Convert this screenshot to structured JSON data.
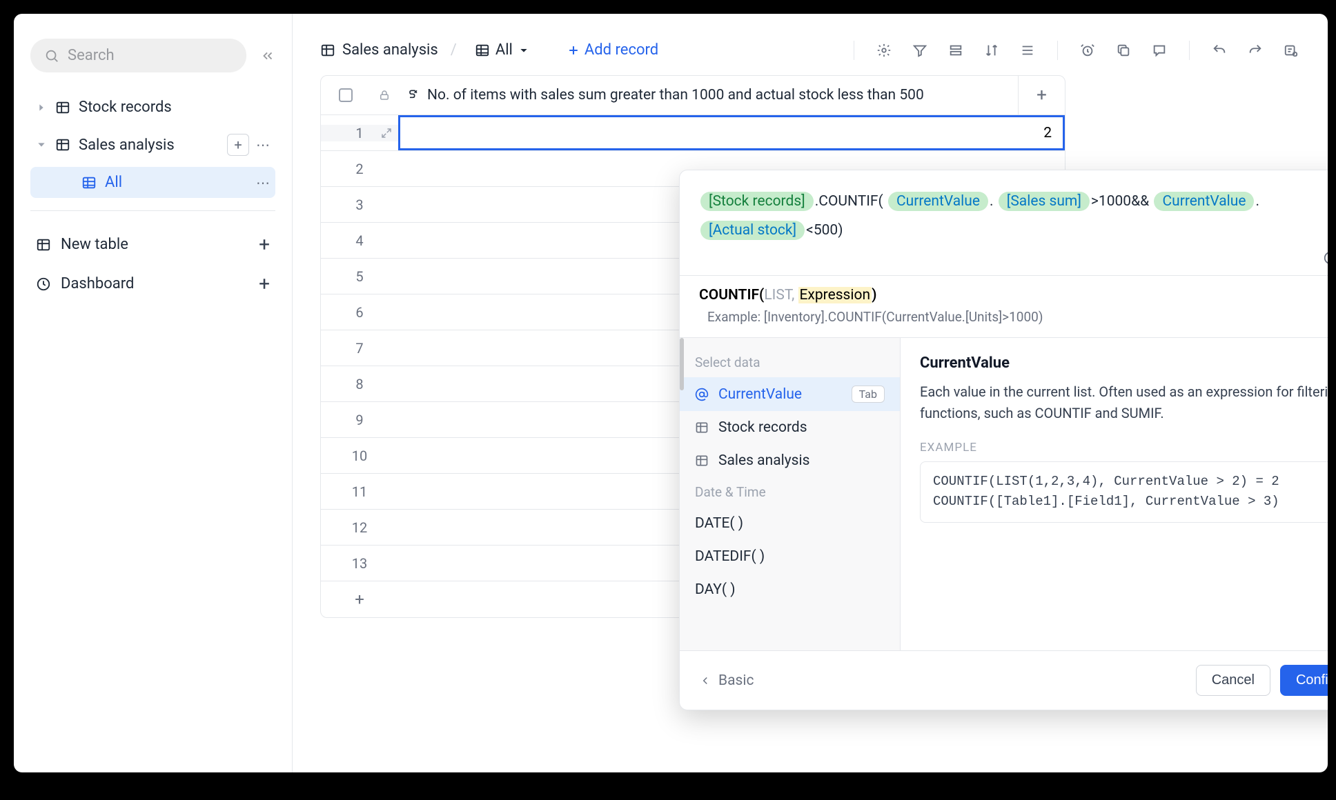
{
  "sidebar": {
    "search_placeholder": "Search",
    "tables": [
      {
        "label": "Stock records",
        "expanded": false
      },
      {
        "label": "Sales analysis",
        "expanded": true,
        "views": [
          {
            "label": "All",
            "active": true
          }
        ]
      }
    ],
    "actions": {
      "new_table": "New table",
      "dashboard": "Dashboard"
    }
  },
  "header": {
    "table": "Sales analysis",
    "view": "All",
    "add_record": "Add record"
  },
  "grid": {
    "column_label": "No. of items with sales sum greater than 1000 and actual stock less than 500",
    "rows": [
      {
        "n": 1,
        "value": "2",
        "selected": true
      },
      {
        "n": 2
      },
      {
        "n": 3
      },
      {
        "n": 4
      },
      {
        "n": 5
      },
      {
        "n": 6
      },
      {
        "n": 7
      },
      {
        "n": 8
      },
      {
        "n": 9
      },
      {
        "n": 10
      },
      {
        "n": 11
      },
      {
        "n": 12
      },
      {
        "n": 13
      }
    ]
  },
  "formula": {
    "tokens": {
      "stock_records": "[Stock records]",
      "countif": ".COUNTIF(",
      "current_value_1": "CurrentValue",
      "dot": ".",
      "sales_sum": "[Sales sum]",
      "gt_and": ">1000&&",
      "current_value_2": "CurrentValue",
      "dot2": ".",
      "actual_stock": "[Actual stock]",
      "lt_close": "<500)"
    },
    "signature": {
      "name": "COUNTIF(",
      "arg1": "LIST",
      "comma": ", ",
      "arg2": "Expression",
      "close": ")",
      "example": "Example: [Inventory].COUNTIF(CurrentValue.[Units]>1000)"
    },
    "suggestions": {
      "cat1": "Select data",
      "items1": [
        {
          "label": "CurrentValue",
          "icon": "at",
          "selected": true,
          "badge": "Tab"
        },
        {
          "label": "Stock records",
          "icon": "table"
        },
        {
          "label": "Sales analysis",
          "icon": "table"
        }
      ],
      "cat2": "Date & Time",
      "items2": [
        {
          "label": "DATE( )"
        },
        {
          "label": "DATEDIF( )"
        },
        {
          "label": "DAY( )"
        }
      ]
    },
    "doc": {
      "title": "CurrentValue",
      "desc": "Each value in the current list. Often used as an expression for filtering functions, such as COUNTIF and SUMIF.",
      "example_label": "EXAMPLE",
      "example_code": "COUNTIF(LIST(1,2,3,4), CurrentValue > 2) = 2\nCOUNTIF([Table1].[Field1], CurrentValue > 3)"
    },
    "footer": {
      "back": "Basic",
      "cancel": "Cancel",
      "confirm": "Confirm"
    }
  }
}
